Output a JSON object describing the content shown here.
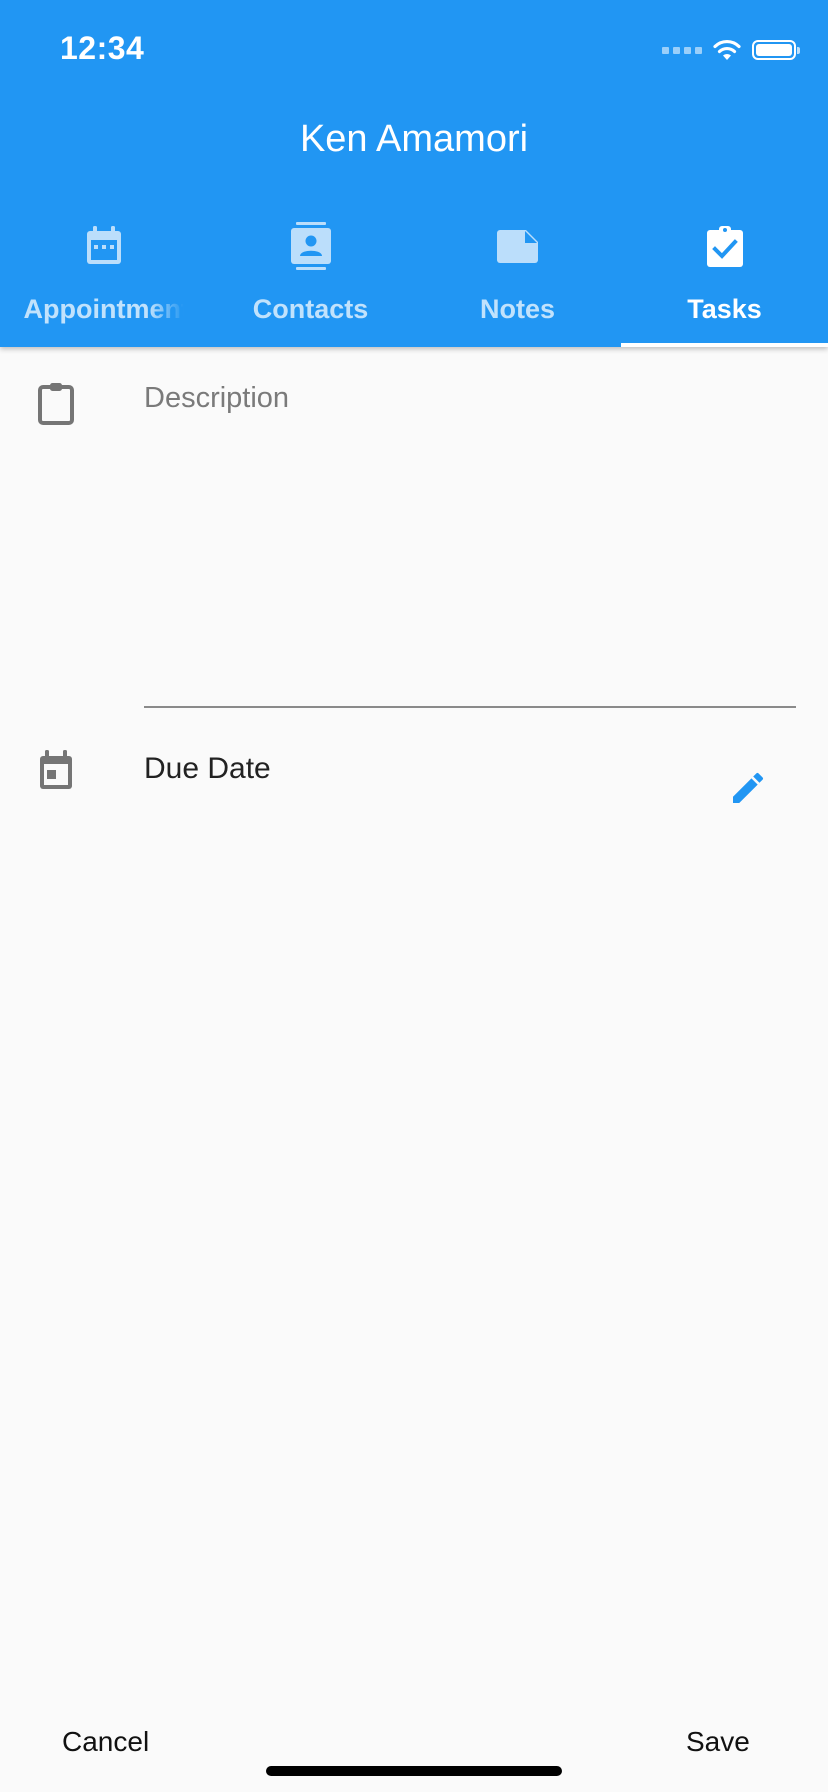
{
  "status_bar": {
    "time": "12:34"
  },
  "header": {
    "title": "Ken Amamori"
  },
  "tabs": [
    {
      "label": "Appointments",
      "icon": "calendar-icon",
      "active": false
    },
    {
      "label": "Contacts",
      "icon": "contact-card-icon",
      "active": false
    },
    {
      "label": "Notes",
      "icon": "note-icon",
      "active": false
    },
    {
      "label": "Tasks",
      "icon": "clipboard-check-icon",
      "active": true
    }
  ],
  "form": {
    "description": {
      "placeholder": "Description",
      "value": "",
      "icon": "clipboard-icon"
    },
    "due_date": {
      "label": "Due Date",
      "icon": "calendar-event-icon",
      "edit_icon": "pencil-icon"
    }
  },
  "actions": {
    "cancel_label": "Cancel",
    "save_label": "Save"
  },
  "colors": {
    "primary": "#2196f3",
    "background": "#fafafa",
    "icon_gray": "#757575",
    "tab_inactive": "rgba(255,255,255,0.72)"
  }
}
